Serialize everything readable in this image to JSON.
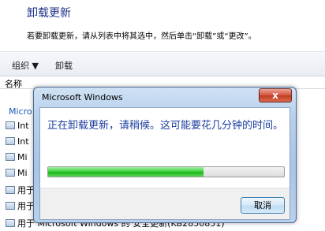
{
  "header": {
    "title": "卸载更新",
    "description": "若要卸载更新，请从列表中将其选中，然后单击“卸载”或“更改”。"
  },
  "toolbar": {
    "organize_label": "组织 ▼",
    "uninstall_label": "卸载"
  },
  "list": {
    "column_name": "名称",
    "group_label": "Micro",
    "rows": [
      "Int",
      "Int",
      "Mi",
      "Mi",
      "用于",
      "用于",
      "用于 Microsoft Windows 的 安全更新(KB2850851)"
    ]
  },
  "dialog": {
    "title": "Microsoft Windows",
    "close_glyph": "x",
    "message": "正在卸载更新，请稍候。这可能要花几分钟的时间。",
    "progress": 0.66,
    "cancel_label": "取消"
  }
}
